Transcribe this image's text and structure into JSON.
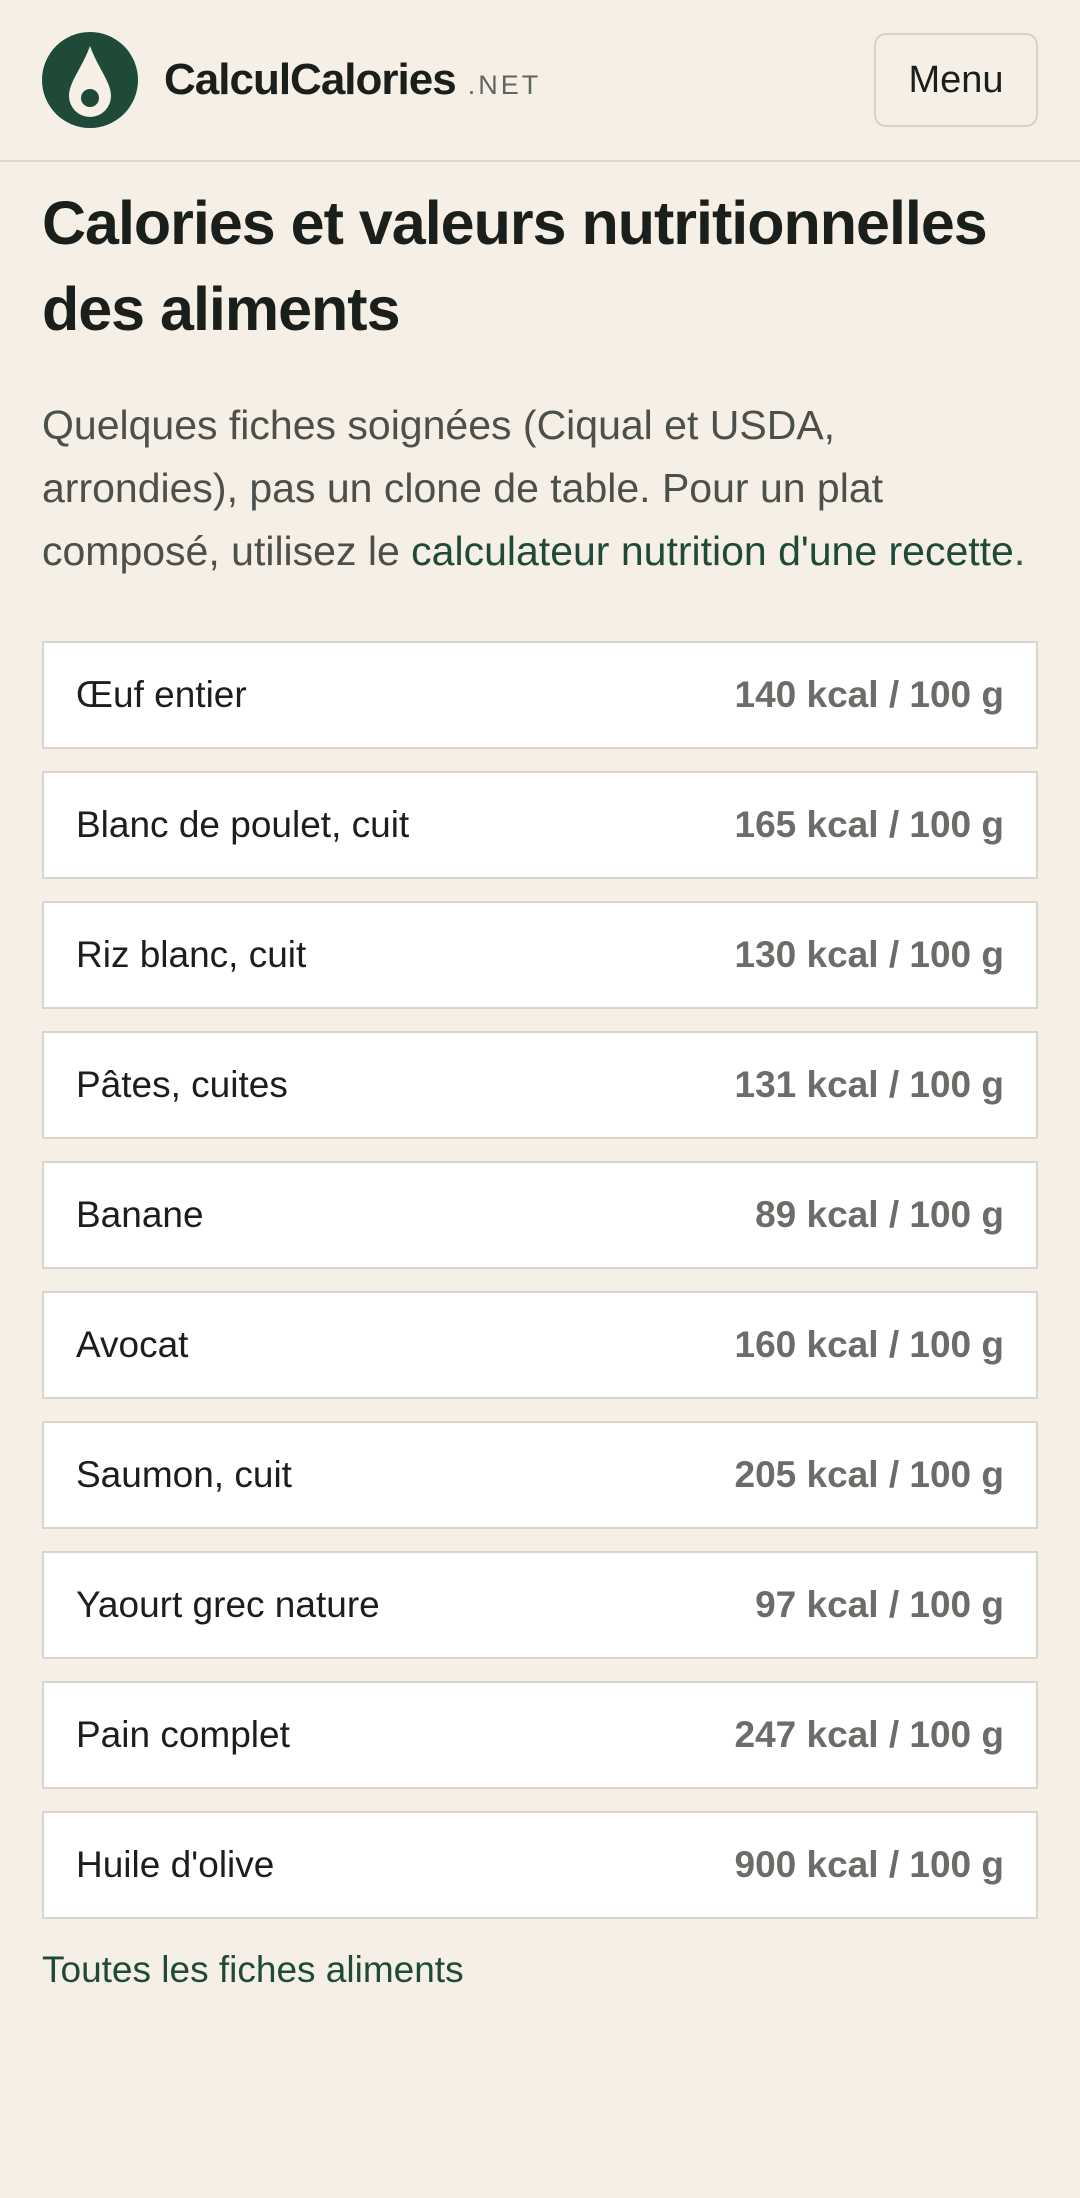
{
  "header": {
    "brand_name": "CalculCalories",
    "brand_tld": ".NET",
    "menu_label": "Menu"
  },
  "page": {
    "title": "Calories et valeurs nutritionnelles des aliments",
    "intro_text": "Quelques fiches soignées (Ciqual et USDA, arrondies), pas un clone de table. Pour un plat composé, utilisez le ",
    "intro_link": "calculateur nutrition d'une recette",
    "intro_end": ".",
    "all_foods_link": "Toutes les fiches aliments"
  },
  "foods": [
    {
      "name": "Œuf entier",
      "kcal": "140 kcal / 100 g"
    },
    {
      "name": "Blanc de poulet, cuit",
      "kcal": "165 kcal / 100 g"
    },
    {
      "name": "Riz blanc, cuit",
      "kcal": "130 kcal / 100 g"
    },
    {
      "name": "Pâtes, cuites",
      "kcal": "131 kcal / 100 g"
    },
    {
      "name": "Banane",
      "kcal": "89 kcal / 100 g"
    },
    {
      "name": "Avocat",
      "kcal": "160 kcal / 100 g"
    },
    {
      "name": "Saumon, cuit",
      "kcal": "205 kcal / 100 g"
    },
    {
      "name": "Yaourt grec nature",
      "kcal": "97 kcal / 100 g"
    },
    {
      "name": "Pain complet",
      "kcal": "247 kcal / 100 g"
    },
    {
      "name": "Huile d'olive",
      "kcal": "900 kcal / 100 g"
    }
  ],
  "colors": {
    "background": "#f5efe5",
    "brand_green": "#1f4a38",
    "muted_text": "#6a6d68"
  },
  "icons": {
    "logo": "drop-logo-icon"
  }
}
